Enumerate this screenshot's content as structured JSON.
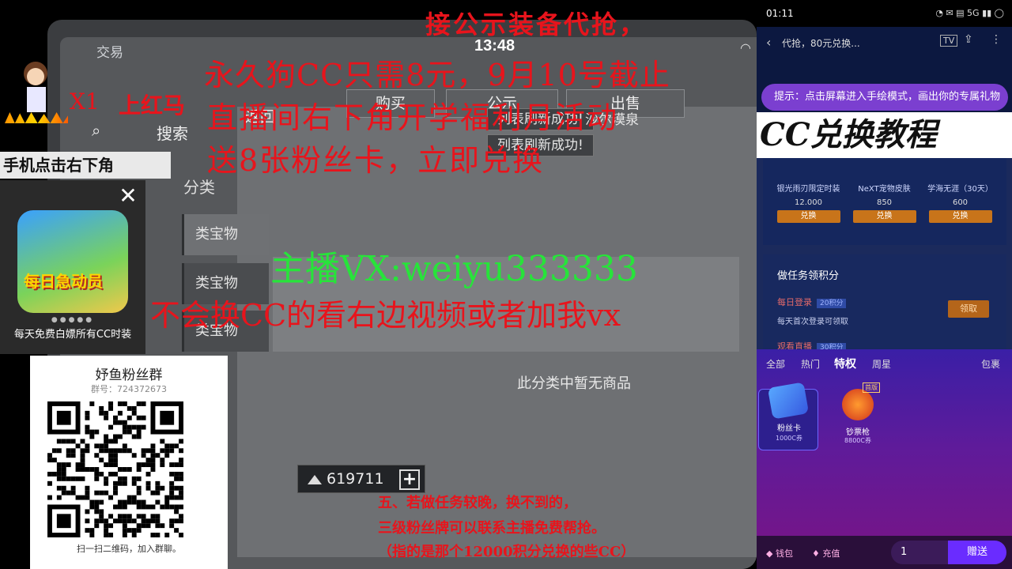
{
  "game": {
    "trade_label": "交易",
    "clock": "13:48",
    "tabs": [
      "购买",
      "公示",
      "出售"
    ],
    "back_label": "返回",
    "search_label": "搜索",
    "category_label": "分类",
    "side_items": [
      "类宝物",
      "类宝物",
      "类宝物"
    ],
    "toast_1": "列表刷新成功!",
    "toast_2": "列表刷新成功!",
    "sidebar_partial": "沙尔漠泉",
    "empty_text": "此分类中暂无商品",
    "balance": "619711",
    "plus": "+"
  },
  "overlay": {
    "top_banner": "接公示装备代抢，",
    "line1": "永久狗CC只需8元，9月10号截止",
    "line2": "直播间右下角开学福利月活动",
    "line3": "送8张粉丝卡，立即兑换",
    "vx": "主播VX:weiyu333333",
    "vx_hint": "不会换CC的看右边视频或者加我vx",
    "x1": "X1",
    "shanghongma": "上红马",
    "bottom_note_1": "五、若做任务较晚，换不到的，",
    "bottom_note_2": "三级粉丝牌可以联系主播免费帮抢。",
    "bottom_note_3": "（指的是那个12000积分兑换的些CC）"
  },
  "left": {
    "phone_hint": "手机点击右下角",
    "promo_caption": "每天免费白嫖所有CC时装",
    "promo_art_text": "每日急动员",
    "promo_dots": "●●●●●",
    "close": "✕",
    "group_title": "妤鱼粉丝群",
    "group_number": "群号：724372673",
    "qr_footer": "扫一扫二维码，加入群聊。"
  },
  "phone": {
    "time": "01:11",
    "status_right": "◔ ✉ ▤ 5G ▮▮ ◯",
    "tip": "提示：点击屏幕进入手绘模式，画出你的专属礼物",
    "cc_tutorial": "CC兑换教程",
    "shop_title": "代抢，80元兑换...",
    "shop_items": [
      {
        "name": "银光雨刃限定时装",
        "price": "12.000",
        "btn": "兑换"
      },
      {
        "name": "NeXT宠物皮肤",
        "price": "850",
        "btn": "兑换"
      },
      {
        "name": "学海无涯（30天）",
        "price": "600",
        "btn": "兑换"
      }
    ],
    "tasks_title": "做任务领积分",
    "task1_name": "每日登录",
    "task1_badge": "20积分",
    "task1_desc": "每天首次登录可领取",
    "task1_btn": "领取",
    "task2_name": "观看直播",
    "task2_badge": "30积分",
    "gift_tabs": [
      "全部",
      "热门",
      "特权",
      "周星"
    ],
    "gift_tab_active": "特权",
    "gift_bag": "包裹",
    "gift1_name": "粉丝卡",
    "gift1_price": "1000C券",
    "gift2_name": "钞票枪",
    "gift2_price": "8800C券",
    "gift2_tag": "首版",
    "wallet": "钱包",
    "recharge": "充值",
    "qty": "1",
    "send": "赠送"
  },
  "colors": {
    "overlay_red": "#e8141c",
    "overlay_green": "#27e43a",
    "tip_purple": "#7b3fd0",
    "send_purple": "#6a2cff"
  }
}
